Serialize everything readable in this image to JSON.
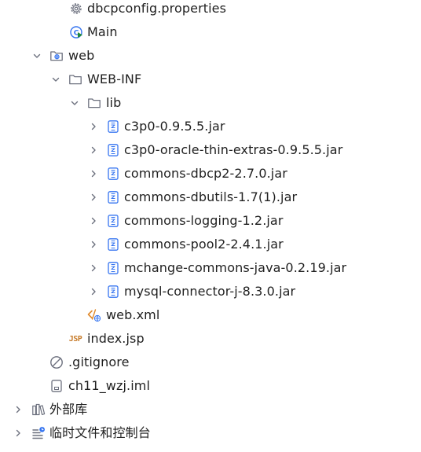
{
  "tree": {
    "items": [
      {
        "label": "dbcpconfig.properties",
        "icon": "gear-icon"
      },
      {
        "label": "Main",
        "icon": "run-class-icon"
      },
      {
        "label": "web",
        "icon": "web-folder-icon",
        "expanded": true
      },
      {
        "label": "WEB-INF",
        "icon": "folder-icon",
        "expanded": true
      },
      {
        "label": "lib",
        "icon": "folder-icon",
        "expanded": true
      },
      {
        "label": "c3p0-0.9.5.5.jar",
        "icon": "jar-icon",
        "expanded": false
      },
      {
        "label": "c3p0-oracle-thin-extras-0.9.5.5.jar",
        "icon": "jar-icon",
        "expanded": false
      },
      {
        "label": "commons-dbcp2-2.7.0.jar",
        "icon": "jar-icon",
        "expanded": false
      },
      {
        "label": "commons-dbutils-1.7(1).jar",
        "icon": "jar-icon",
        "expanded": false
      },
      {
        "label": "commons-logging-1.2.jar",
        "icon": "jar-icon",
        "expanded": false
      },
      {
        "label": "commons-pool2-2.4.1.jar",
        "icon": "jar-icon",
        "expanded": false
      },
      {
        "label": "mchange-commons-java-0.2.19.jar",
        "icon": "jar-icon",
        "expanded": false
      },
      {
        "label": "mysql-connector-j-8.3.0.jar",
        "icon": "jar-icon",
        "expanded": false
      },
      {
        "label": "web.xml",
        "icon": "xml-file-icon"
      },
      {
        "label": "index.jsp",
        "icon": "jsp-file-icon",
        "icon_text": "JSP"
      },
      {
        "label": ".gitignore",
        "icon": "ignored-file-icon"
      },
      {
        "label": "ch11_wzj.iml",
        "icon": "iml-file-icon"
      },
      {
        "label": "外部库",
        "icon": "library-icon",
        "expanded": false
      },
      {
        "label": "临时文件和控制台",
        "icon": "scratches-icon",
        "expanded": false
      }
    ]
  },
  "colors": {
    "text": "#1f1f1f",
    "icon_gray": "#6c707e",
    "jar_blue": "#3574f0",
    "run_green": "#208a3c",
    "jsp_orange": "#c77b2a",
    "xml_orange": "#e08a2c"
  }
}
